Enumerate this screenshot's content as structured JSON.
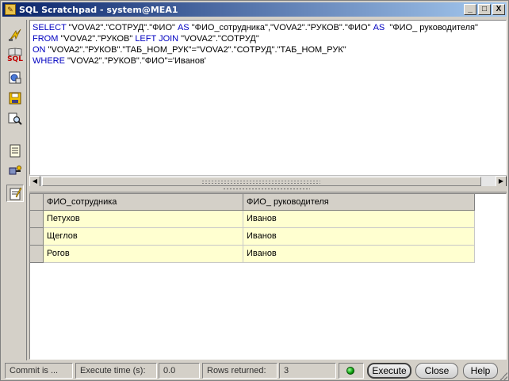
{
  "window": {
    "title": "SQL Scratchpad - system@MEA1",
    "controls": [
      "_",
      "□",
      "X"
    ]
  },
  "toolbar": {
    "items": [
      {
        "icon": "execute-lightning-icon"
      },
      {
        "icon": "sql-book-icon",
        "label": "SQL"
      },
      {
        "icon": "explain-plan-icon"
      },
      {
        "icon": "save-icon"
      },
      {
        "icon": "find-icon"
      },
      {
        "icon": "history-list-icon"
      },
      {
        "icon": "connect-icon"
      },
      {
        "icon": "results-notepad-icon"
      }
    ]
  },
  "editor": {
    "lines": [
      [
        {
          "t": "SELECT",
          "kw": true
        },
        {
          "t": " \"VOVA2\".\"СОТРУД\".\"ФИО\" ",
          "kw": false
        },
        {
          "t": "AS",
          "kw": true
        },
        {
          "t": " \"ФИО_сотрудника\",\"VOVA2\".\"РУКОВ\".\"ФИО\" ",
          "kw": false
        },
        {
          "t": "AS",
          "kw": true
        },
        {
          "t": "  \"ФИО_ руководителя\"",
          "kw": false
        }
      ],
      [
        {
          "t": "FROM",
          "kw": true
        },
        {
          "t": " \"VOVA2\".\"РУКОВ\" ",
          "kw": false
        },
        {
          "t": "LEFT JOIN",
          "kw": true
        },
        {
          "t": " \"VOVA2\".\"СОТРУД\"",
          "kw": false
        }
      ],
      [
        {
          "t": "ON",
          "kw": true
        },
        {
          "t": " \"VOVA2\".\"РУКОВ\".\"ТАБ_НОМ_РУК\"=\"VOVA2\".\"СОТРУД\".\"ТАБ_НОМ_РУК\"",
          "kw": false
        }
      ],
      [
        {
          "t": "WHERE",
          "kw": true
        },
        {
          "t": " \"VOVA2\".\"РУКОВ\".\"ФИО\"='Иванов'",
          "kw": false
        }
      ]
    ]
  },
  "results": {
    "columns": [
      "ФИО_сотрудника",
      "ФИО_ руководителя"
    ],
    "rows": [
      [
        "Петухов",
        "Иванов"
      ],
      [
        "Щеглов",
        "Иванов"
      ],
      [
        "Рогов",
        "Иванов"
      ]
    ]
  },
  "status": {
    "commit": "Commit is ...",
    "exec_label": "Execute time (s):",
    "exec_value": "0.0",
    "rows_label": "Rows returned:",
    "rows_value": "3",
    "connection_color": "#0a9a0a"
  },
  "buttons": {
    "execute": "Execute",
    "close": "Close",
    "help": "Help"
  }
}
